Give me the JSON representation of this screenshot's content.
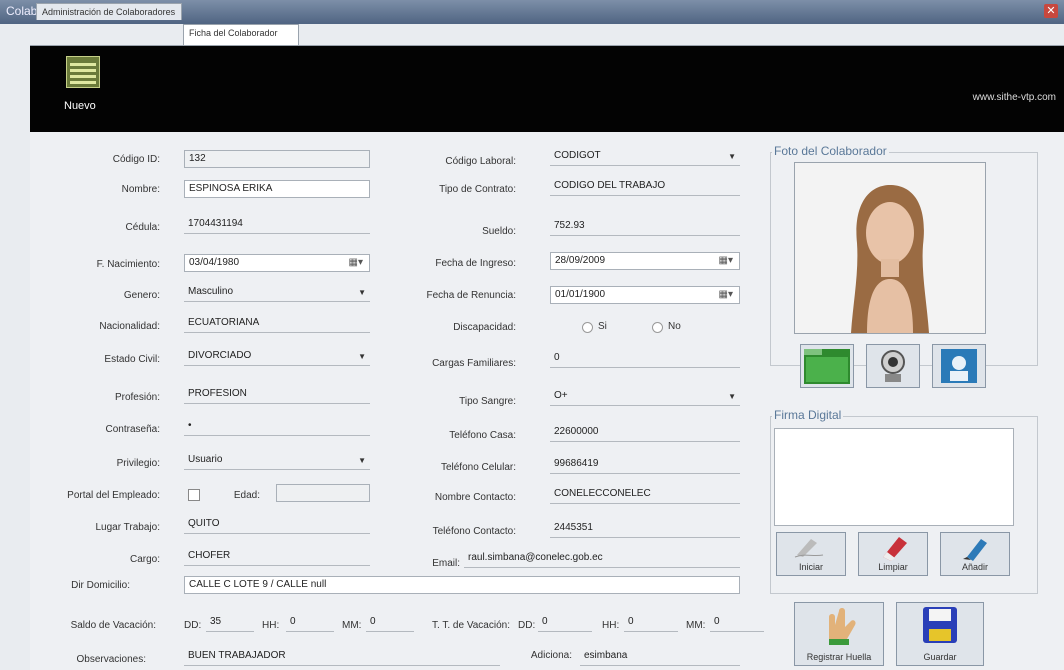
{
  "window": {
    "title": "Colaboradores",
    "close": "✕"
  },
  "tabs": [
    {
      "label": "Administración de Colaboradores"
    },
    {
      "label": "Ficha del Colaborador"
    }
  ],
  "toolbar": {
    "new_label": "Nuevo",
    "url": "www.sithe-vtp.com"
  },
  "form": {
    "codigo_id": {
      "label": "Código ID:",
      "value": "132"
    },
    "nombre": {
      "label": "Nombre:",
      "value": "ESPINOSA ERIKA"
    },
    "cedula": {
      "label": "Cédula:",
      "value": "1704431194"
    },
    "f_nacimiento": {
      "label": "F. Nacimiento:",
      "value": "03/04/1980"
    },
    "genero": {
      "label": "Genero:",
      "value": "Masculino"
    },
    "nacionalidad": {
      "label": "Nacionalidad:",
      "value": "ECUATORIANA"
    },
    "estado_civil": {
      "label": "Estado Civil:",
      "value": "DIVORCIADO"
    },
    "profesion": {
      "label": "Profesión:",
      "value": "PROFESION"
    },
    "contrasena": {
      "label": "Contraseña:",
      "value": "•"
    },
    "privilegio": {
      "label": "Privilegio:",
      "value": "Usuario"
    },
    "portal": {
      "label": "Portal del Empleado:",
      "edad_label": "Edad:",
      "edad_value": ""
    },
    "lugar_trabajo": {
      "label": "Lugar Trabajo:",
      "value": "QUITO"
    },
    "cargo": {
      "label": "Cargo:",
      "value": "CHOFER"
    },
    "dir_domicilio": {
      "label": "Dir Domicilio:",
      "value": "CALLE C LOTE 9 / CALLE null"
    },
    "codigo_laboral": {
      "label": "Código Laboral:",
      "value": "CODIGOT"
    },
    "tipo_contrato": {
      "label": "Tipo de Contrato:",
      "value": "CODIGO DEL TRABAJO"
    },
    "sueldo": {
      "label": "Sueldo:",
      "value": "752.93"
    },
    "fecha_ingreso": {
      "label": "Fecha de Ingreso:",
      "value": "28/09/2009"
    },
    "fecha_renuncia": {
      "label": "Fecha de Renuncia:",
      "value": "01/01/1900"
    },
    "discapacidad": {
      "label": "Discapacidad:",
      "si": "Si",
      "no": "No"
    },
    "cargas_familiares": {
      "label": "Cargas Familiares:",
      "value": "0"
    },
    "tipo_sangre": {
      "label": "Tipo Sangre:",
      "value": "O+"
    },
    "telefono_casa": {
      "label": "Teléfono Casa:",
      "value": "22600000"
    },
    "telefono_celular": {
      "label": "Teléfono Celular:",
      "value": "99686419"
    },
    "nombre_contacto": {
      "label": "Nombre Contacto:",
      "value": "CONELECCONELEC"
    },
    "telefono_contacto": {
      "label": "Teléfono Contacto:",
      "value": "2445351"
    },
    "email": {
      "label": "Email:",
      "value": "raul.simbana@conelec.gob.ec"
    },
    "saldo_vacacion": {
      "label": "Saldo de Vacación:",
      "dd_label": "DD:",
      "dd": "35",
      "hh_label": "HH:",
      "hh": "0",
      "mm_label": "MM:",
      "mm": "0"
    },
    "tt_vacacion": {
      "label": "T. T. de Vacación:",
      "dd_label": "DD:",
      "dd": "0",
      "hh_label": "HH:",
      "hh": "0",
      "mm_label": "MM:",
      "mm": "0"
    },
    "observaciones": {
      "label": "Observaciones:",
      "value": "BUEN TRABAJADOR"
    },
    "adiciona": {
      "label": "Adiciona:",
      "value": "esimbana"
    }
  },
  "foto": {
    "title": "Foto del Colaborador"
  },
  "firma": {
    "title": "Firma Digital",
    "iniciar": "Iniciar",
    "limpiar": "Limpiar",
    "anadir": "Añadir"
  },
  "actions": {
    "registrar_huella": "Registrar Huella",
    "guardar": "Guardar"
  },
  "colors": {
    "toolbar": "#030303",
    "group_title": "#5a7898"
  }
}
